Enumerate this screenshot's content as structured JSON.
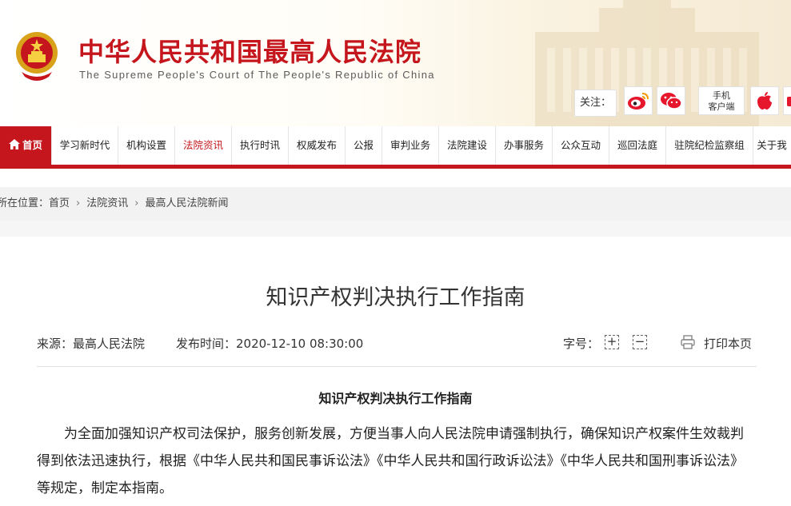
{
  "header": {
    "title": "中华人民共和国最高人民法院",
    "subtitle": "The Supreme People's Court of The People's Republic of China",
    "follow_label": "关注：",
    "mobile_line1": "手机",
    "mobile_line2": "客户端"
  },
  "nav": {
    "items": [
      {
        "label": "首页"
      },
      {
        "label": "学习新时代"
      },
      {
        "label": "机构设置"
      },
      {
        "label": "法院资讯"
      },
      {
        "label": "执行时讯"
      },
      {
        "label": "权威发布"
      },
      {
        "label": "公报"
      },
      {
        "label": "审判业务"
      },
      {
        "label": "法院建设"
      },
      {
        "label": "办事服务"
      },
      {
        "label": "公众互动"
      },
      {
        "label": "巡回法庭"
      },
      {
        "label": "驻院纪检监察组"
      },
      {
        "label": "关于我"
      }
    ],
    "active_index": 3
  },
  "breadcrumb": {
    "prefix": "所在位置：",
    "items": [
      "首页",
      "法院资讯",
      "最高人民法院新闻"
    ]
  },
  "article": {
    "title": "知识产权判决执行工作指南",
    "source": "来源：最高人民法院",
    "published": "发布时间：2020-12-10 08:30:00",
    "font_size_label": "字号：",
    "font_plus": "+",
    "font_minus": "−",
    "print_label": "打印本页",
    "sub_title": "知识产权判决执行工作指南",
    "paragraph": "为全面加强知识产权司法保护，服务创新发展，方便当事人向人民法院申请强制执行，确保知识产权案件生效裁判得到依法迅速执行，根据《中华人民共和国民事诉讼法》《中华人民共和国行政诉讼法》《中华人民共和国刑事诉讼法》等规定，制定本指南。"
  },
  "colors": {
    "brand_red": "#c4161c",
    "breadcrumb_bg": "#f2f2f2"
  },
  "icons": [
    "national-emblem-icon",
    "weibo-icon",
    "wechat-icon",
    "apple-icon",
    "android-icon",
    "home-icon",
    "print-icon"
  ]
}
